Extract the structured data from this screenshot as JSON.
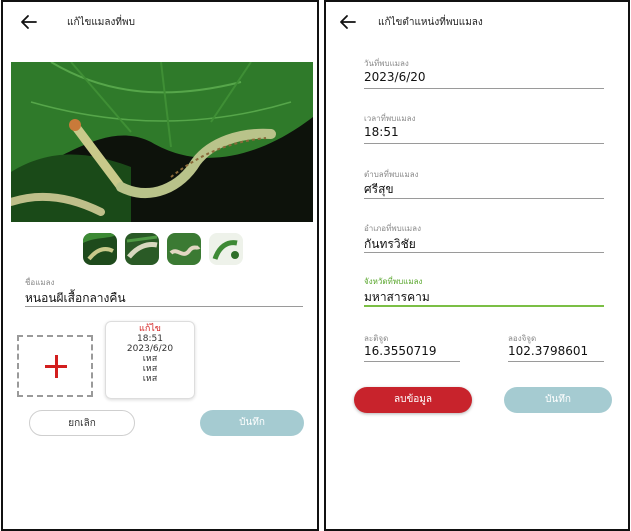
{
  "left": {
    "title": "แก้ไขแมลงที่พบ",
    "insect_name_label": "ชื่อแมลง",
    "insect_name_value": "หนอนผีเสื้อกลางคืน",
    "record_card": {
      "edit_label": "แก้ไข",
      "time": "18:51",
      "date": "2023/6/20",
      "line1": "เหส",
      "line2": "เหส",
      "line3": "เหส"
    },
    "cancel_label": "ยกเลิก",
    "save_label": "บันทึก"
  },
  "right": {
    "title": "แก้ไขตำแหน่งที่พบแมลง",
    "fields": {
      "date": {
        "label": "วันที่พบแมลง",
        "value": "2023/6/20"
      },
      "time": {
        "label": "เวลาที่พบแมลง",
        "value": "18:51"
      },
      "subdistrict": {
        "label": "ตำบลที่พบแมลง",
        "value": "ศรีสุข"
      },
      "district": {
        "label": "อำเภอที่พบแมลง",
        "value": "กันทรวิชัย"
      },
      "province": {
        "label": "จังหวัดที่พบแมลง",
        "value": "มหาสารคาม"
      },
      "latitude": {
        "label": "ละติจูด",
        "value": "16.3550719"
      },
      "longitude": {
        "label": "ลองจิจูด",
        "value": "102.3798601"
      }
    },
    "delete_label": "ลบข้อมูล",
    "save_label": "บันทึก"
  },
  "colors": {
    "accent_red": "#c8232c",
    "teal_button": "#a5cbd1",
    "active_underline": "#7bbf45"
  }
}
